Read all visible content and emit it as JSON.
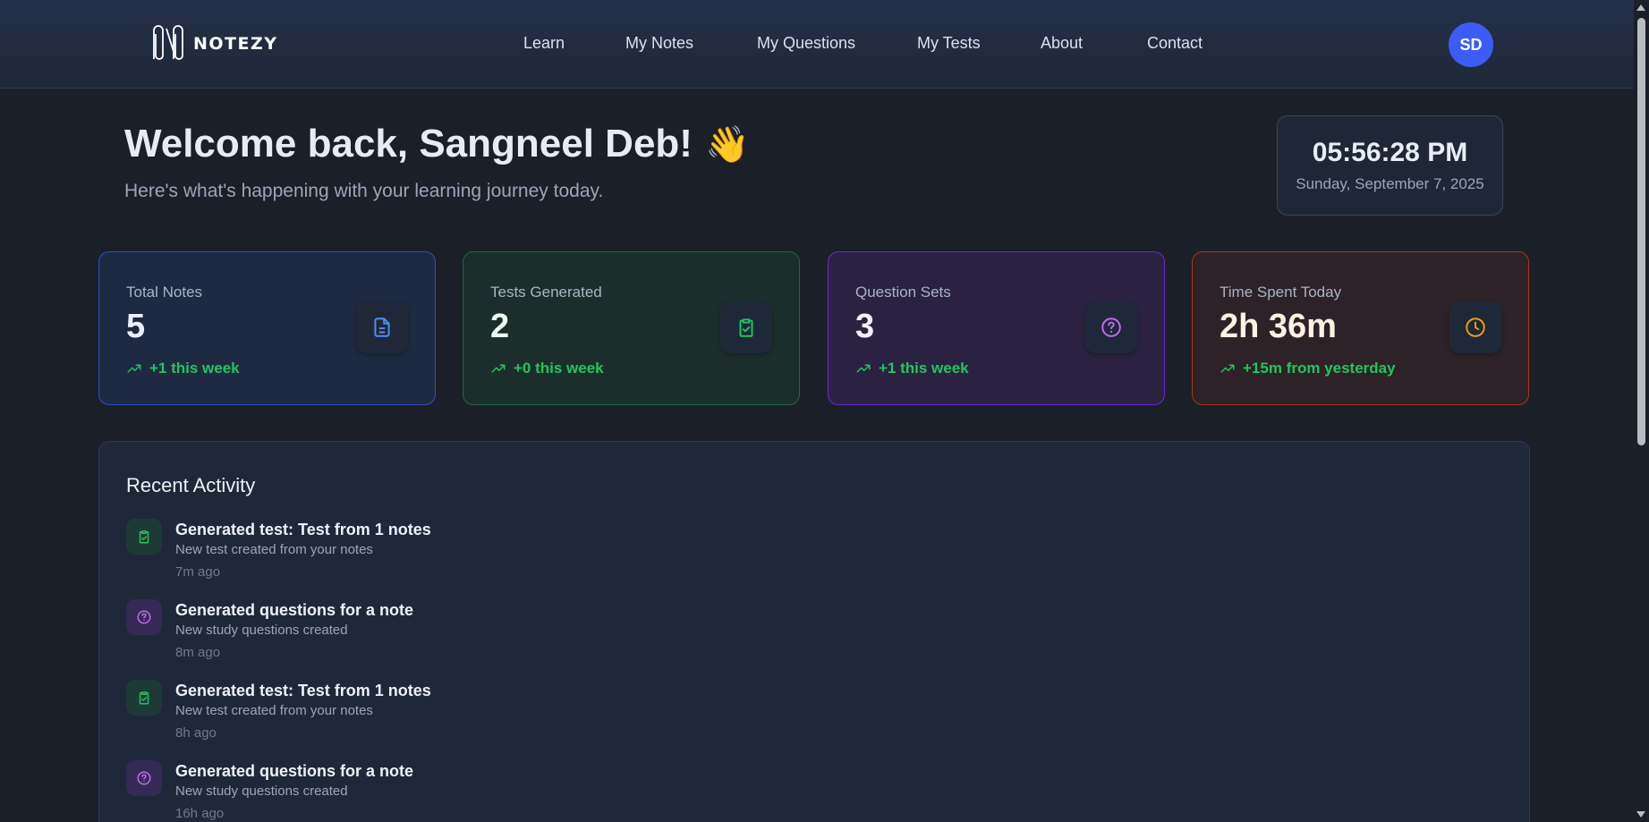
{
  "nav": {
    "logo_text": "NOTEZY",
    "links": [
      "Learn",
      "My Notes",
      "My Questions",
      "My Tests",
      "About",
      "Contact"
    ],
    "avatar_initials": "SD"
  },
  "welcome": {
    "title": "Welcome back, Sangneel Deb!",
    "emoji": "👋",
    "subtitle": "Here's what's happening with your learning journey today."
  },
  "clock": {
    "time": "05:56:28 PM",
    "date": "Sunday, September 7, 2025"
  },
  "stats": [
    {
      "label": "Total Notes",
      "value": "5",
      "change": "+1 this week",
      "icon": "document-icon",
      "color": "#4f8ef7"
    },
    {
      "label": "Tests Generated",
      "value": "2",
      "change": "+0 this week",
      "icon": "clipboard-check-icon",
      "color": "#22c55e"
    },
    {
      "label": "Question Sets",
      "value": "3",
      "change": "+1 this week",
      "icon": "question-circle-icon",
      "color": "#c06cf0"
    },
    {
      "label": "Time Spent Today",
      "value": "2h 36m",
      "change": "+15m from yesterday",
      "icon": "clock-icon",
      "color": "#f59e0b"
    }
  ],
  "recent": {
    "title": "Recent Activity",
    "items": [
      {
        "title": "Generated test: Test from 1 notes",
        "desc": "New test created from your notes",
        "time": "7m ago",
        "icon": "clipboard-check-icon",
        "kind": "test"
      },
      {
        "title": "Generated questions for a note",
        "desc": "New study questions created",
        "time": "8m ago",
        "icon": "question-circle-icon",
        "kind": "question"
      },
      {
        "title": "Generated test: Test from 1 notes",
        "desc": "New test created from your notes",
        "time": "8h ago",
        "icon": "clipboard-check-icon",
        "kind": "test"
      },
      {
        "title": "Generated questions for a note",
        "desc": "New study questions created",
        "time": "16h ago",
        "icon": "question-circle-icon",
        "kind": "question"
      }
    ]
  }
}
